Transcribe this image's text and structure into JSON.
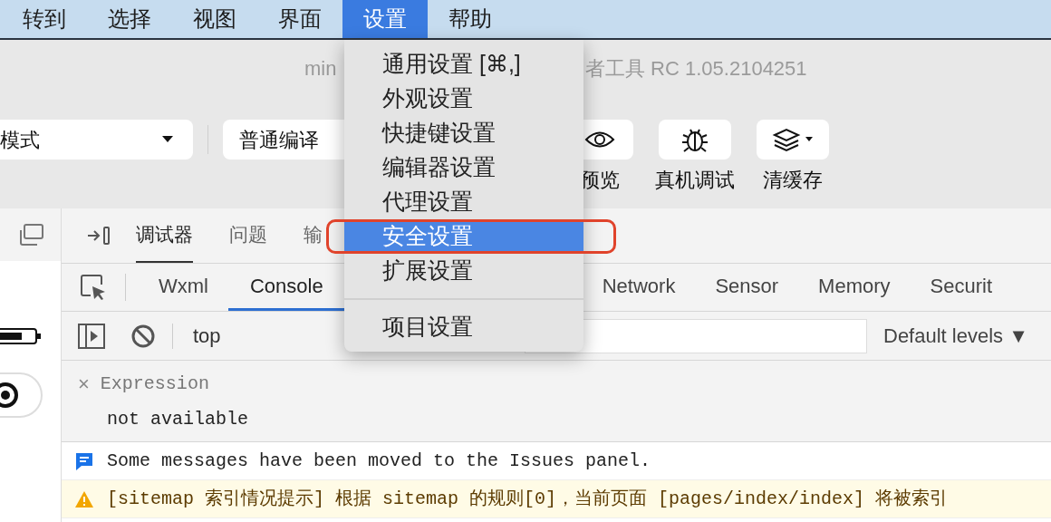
{
  "menu_bar": [
    {
      "label": "转到",
      "selected": false
    },
    {
      "label": "选择",
      "selected": false
    },
    {
      "label": "视图",
      "selected": false
    },
    {
      "label": "界面",
      "selected": false
    },
    {
      "label": "设置",
      "selected": true
    },
    {
      "label": "帮助",
      "selected": false
    }
  ],
  "dropdown": {
    "sections": [
      {
        "items": [
          {
            "label": "通用设置 [⌘,]",
            "selected": false
          },
          {
            "label": "外观设置",
            "selected": false
          },
          {
            "label": "快捷键设置",
            "selected": false
          },
          {
            "label": "编辑器设置",
            "selected": false
          },
          {
            "label": "代理设置",
            "selected": false
          },
          {
            "label": "安全设置",
            "selected": true
          },
          {
            "label": "扩展设置",
            "selected": false
          }
        ]
      },
      {
        "items": [
          {
            "label": "项目设置",
            "selected": false
          }
        ]
      }
    ]
  },
  "title": {
    "left": "min",
    "right": "者工具 RC 1.05.2104251"
  },
  "toolbar": {
    "mode_select": "模式",
    "compile_select": "普通编译",
    "buttons": [
      {
        "kind": "preview",
        "label": "预览"
      },
      {
        "kind": "debug",
        "label": "真机调试"
      },
      {
        "kind": "cache",
        "label": "清缓存"
      }
    ]
  },
  "devtools": {
    "panel_tabs": [
      {
        "label": "调试器",
        "selected": true
      },
      {
        "label": "问题",
        "selected": false
      },
      {
        "label": "输",
        "selected": false
      }
    ],
    "tool_tabs": [
      {
        "label": "Wxml",
        "selected": false
      },
      {
        "label": "Console",
        "selected": true
      },
      {
        "label": "Network",
        "selected": false
      },
      {
        "label": "Sensor",
        "selected": false
      },
      {
        "label": "Memory",
        "selected": false
      },
      {
        "label": "Securit",
        "selected": false
      }
    ],
    "context": "top",
    "levels": "Default levels ▼",
    "expression": {
      "close": "×",
      "label": "Expression",
      "value": "not available"
    },
    "messages": [
      {
        "kind": "info",
        "text": "Some messages have been moved to the Issues panel."
      },
      {
        "kind": "warning",
        "text": "[sitemap 索引情况提示] 根据 sitemap 的规则[0]，当前页面 [pages/index/index] 将被索引"
      }
    ]
  }
}
